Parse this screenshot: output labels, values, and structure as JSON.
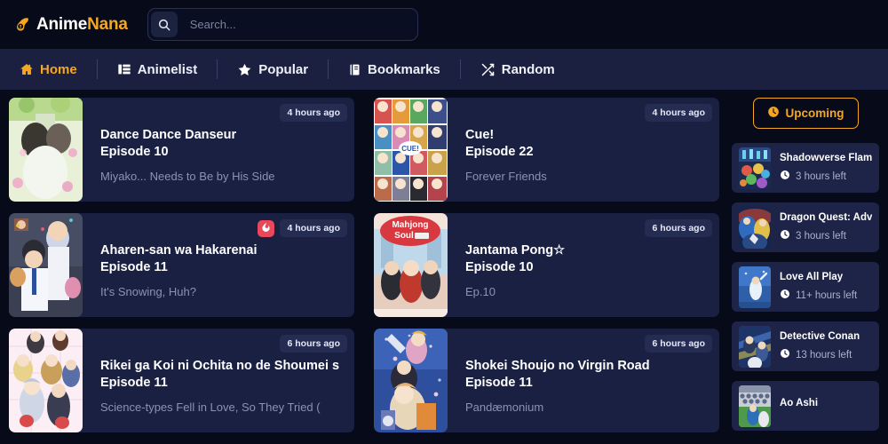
{
  "brand": {
    "name_primary": "Anime",
    "name_accent": "Nana",
    "icon": "comet-icon",
    "accent_color": "#f5a623"
  },
  "search": {
    "placeholder": "Search...",
    "value": "",
    "icon": "search-icon"
  },
  "nav": {
    "items": [
      {
        "label": "Home",
        "icon": "home-icon",
        "active": true
      },
      {
        "label": "Animelist",
        "icon": "list-icon",
        "active": false
      },
      {
        "label": "Popular",
        "icon": "star-icon",
        "active": false
      },
      {
        "label": "Bookmarks",
        "icon": "bookmark-icon",
        "active": false
      },
      {
        "label": "Random",
        "icon": "shuffle-icon",
        "active": false
      }
    ]
  },
  "feed": {
    "episodes": [
      {
        "title": "Dance Dance Danseur",
        "episode": "Episode 10",
        "subtitle": "Miyako... Needs to Be by His Side",
        "time_ago": "4 hours ago",
        "hot": false
      },
      {
        "title": "Cue!",
        "episode": "Episode 22",
        "subtitle": "Forever Friends",
        "time_ago": "4 hours ago",
        "hot": false
      },
      {
        "title": "Aharen-san wa Hakarenai",
        "episode": "Episode 11",
        "subtitle": "It's Snowing, Huh?",
        "time_ago": "4 hours ago",
        "hot": true
      },
      {
        "title": "Jantama Pong☆",
        "episode": "Episode 10",
        "subtitle": "Ep.10",
        "time_ago": "6 hours ago",
        "hot": false
      },
      {
        "title": "Rikei ga Koi ni Ochita no de Shoumei s",
        "episode": "Episode 11",
        "subtitle": "Science-types Fell in Love, So They Tried (",
        "time_ago": "6 hours ago",
        "hot": false
      },
      {
        "title": "Shokei Shoujo no Virgin Road",
        "episode": "Episode 11",
        "subtitle": "Pandæmonium",
        "time_ago": "6 hours ago",
        "hot": false
      }
    ]
  },
  "sidebar": {
    "upcoming_label": "Upcoming",
    "upcoming_icon": "clock-icon",
    "items": [
      {
        "title": "Shadowverse Flame",
        "time_left": "3 hours left",
        "icon": "clock-icon"
      },
      {
        "title": "Dragon Quest: Adven",
        "time_left": "3 hours left",
        "icon": "clock-icon"
      },
      {
        "title": "Love All Play",
        "time_left": "11+ hours left",
        "icon": "clock-icon"
      },
      {
        "title": "Detective Conan",
        "time_left": "13 hours left",
        "icon": "clock-icon"
      },
      {
        "title": "Ao Ashi",
        "time_left": "",
        "icon": "clock-icon"
      }
    ]
  }
}
